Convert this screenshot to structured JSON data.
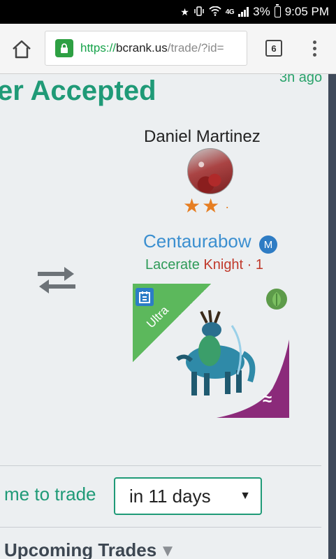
{
  "status_bar": {
    "battery_percent": "3%",
    "time": "9:05 PM",
    "network": "4G",
    "icons": [
      "star-icon",
      "vibrate-icon",
      "wifi-icon",
      "lte-icon",
      "signal-icon",
      "battery-icon"
    ]
  },
  "browser": {
    "url_scheme": "https://",
    "url_host": "bcrank.us",
    "url_path": "/trade/?id=",
    "tab_count": "6"
  },
  "header": {
    "title": "er Accepted",
    "time_ago": "3h ago"
  },
  "partner": {
    "name": "Daniel Martinez",
    "stars": "★★",
    "extra_mark": "·"
  },
  "card": {
    "name": "Centaurabow",
    "rarity_badge": "M",
    "ability": "Lacerate",
    "class_level": "Knight · 1",
    "tier": "Ultra",
    "element_glyph": "≈",
    "element_color": "#8b2a7a"
  },
  "trade_time": {
    "label": "me to trade",
    "selected": "in 11 days",
    "caret": "▼"
  },
  "upcoming": {
    "label": "Upcoming Trades",
    "caret": "▼"
  },
  "colors": {
    "accent": "#1f9a77",
    "link_blue": "#3b8fd0",
    "star_orange": "#e67e22",
    "ability_green": "#2e9a58",
    "class_red": "#c0392b"
  }
}
